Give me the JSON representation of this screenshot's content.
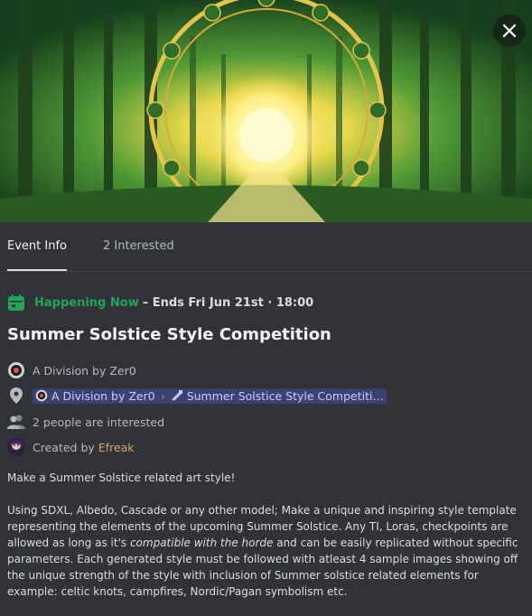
{
  "tabs": [
    {
      "label": "Event Info",
      "active": true
    },
    {
      "label": "2 Interested",
      "active": false
    }
  ],
  "status": {
    "happening": "Happening Now",
    "ends": "– Ends Fri Jun 21st · 18:00"
  },
  "event": {
    "title": "Summer Solstice Style Competition"
  },
  "server": {
    "name": "A Division by Zer0"
  },
  "location": {
    "server": "A Division by Zer0",
    "channel": "Summer Solstice Style Competiti…"
  },
  "interested": {
    "text": "2 people are interested"
  },
  "creator": {
    "prefix": "Created by",
    "name": "Efreak"
  },
  "description": {
    "intro": "Make a Summer Solstice related art style!",
    "body_part1": "Using SDXL, Albedo, Cascade or any other model; Make a unique and inspiring style template representing the elements of the upcoming Summer Solstice. Any TI, Loras, checkpoints are allowed as long as it's ",
    "body_emph": "compatible with the horde",
    "body_part2": " and can be easily replicated without specific parameters. Each generated style must be followed with atleast 4 sample images showing off the unique strength of the style with inclusion of Summer solstice related elements for example: celtic knots, campfires, Nordic/Pagan symbolism etc."
  },
  "colors": {
    "background": "#313338",
    "accent_green": "#23a55a",
    "mention_bg": "#3c4270",
    "creator_name": "#d6a572"
  },
  "icons": [
    "close-icon",
    "calendar-icon",
    "server-avatar",
    "location-pin-icon",
    "people-icon",
    "creator-avatar",
    "channel-icon"
  ]
}
